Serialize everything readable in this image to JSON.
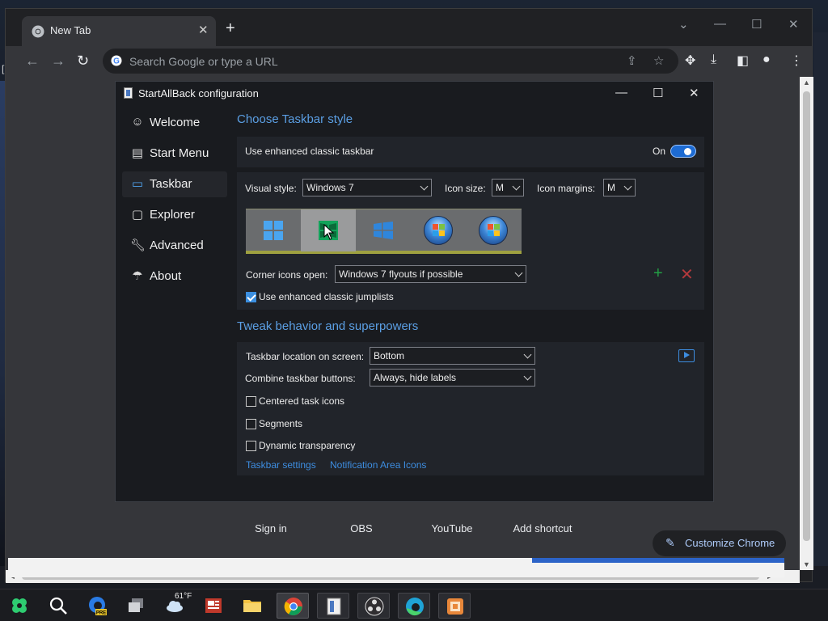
{
  "chrome": {
    "tab_title": "New Tab",
    "omnibox_placeholder": "Search Google or type a URL",
    "shortcuts": [
      "Sign in",
      "OBS",
      "YouTube",
      "Add shortcut"
    ],
    "customize_label": "Customize Chrome"
  },
  "dialog": {
    "title": "StartAllBack configuration",
    "sidebar": [
      {
        "label": "Welcome",
        "icon": "smile-icon",
        "active": false
      },
      {
        "label": "Start Menu",
        "icon": "start-menu-icon",
        "active": false
      },
      {
        "label": "Taskbar",
        "icon": "taskbar-icon",
        "active": true
      },
      {
        "label": "Explorer",
        "icon": "folder-icon",
        "active": false
      },
      {
        "label": "Advanced",
        "icon": "wrench-icon",
        "active": false
      },
      {
        "label": "About",
        "icon": "umbrella-icon",
        "active": false
      }
    ],
    "taskbar_style": {
      "heading": "Choose Taskbar style",
      "enhanced_label": "Use enhanced classic taskbar",
      "toggle_label": "On",
      "visual_style_label": "Visual style:",
      "visual_style_value": "Windows 7",
      "icon_size_label": "Icon size:",
      "icon_size_value": "M",
      "icon_margins_label": "Icon margins:",
      "icon_margins_value": "M",
      "style_options": [
        "windows-11",
        "windows-10-selected",
        "windows-10",
        "windows-vista",
        "windows-7"
      ],
      "corner_icons_label": "Corner icons open:",
      "corner_icons_value": "Windows 7 flyouts if possible",
      "jumplists_label": "Use enhanced classic jumplists"
    },
    "tweak": {
      "heading": "Tweak behavior and superpowers",
      "location_label": "Taskbar location on screen:",
      "location_value": "Bottom",
      "combine_label": "Combine taskbar buttons:",
      "combine_value": "Always, hide labels",
      "centered_label": "Centered task icons",
      "segments_label": "Segments",
      "transparency_label": "Dynamic transparency",
      "link_settings": "Taskbar settings",
      "link_notification": "Notification Area Icons"
    }
  },
  "taskbar": {
    "weather_temp": "61°F",
    "apps": [
      "start",
      "search",
      "edge-beta",
      "task-view",
      "weather",
      "news",
      "file-explorer",
      "chrome",
      "startallback",
      "obs",
      "edge",
      "app"
    ]
  },
  "colors": {
    "accent": "#5b9fe4",
    "link": "#3d8de0",
    "toggle_on": "#1d6bd3"
  }
}
